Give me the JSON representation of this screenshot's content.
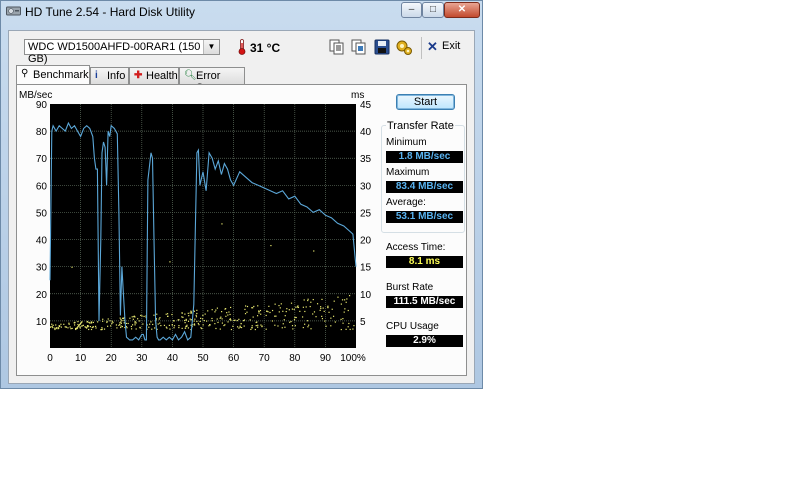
{
  "window": {
    "title": "HD Tune 2.54 - Hard Disk Utility",
    "caption_minimize": "–",
    "caption_maximize": "□",
    "caption_close": "✕"
  },
  "toolbar": {
    "drive": "WDC WD1500AHFD-00RAR1 (150 GB)",
    "temperature": "31 °C",
    "exit_label": "Exit",
    "icons": [
      "copy-text-icon",
      "copy-screenshot-icon",
      "save-icon",
      "options-icon",
      "exit-icon"
    ]
  },
  "tabs": [
    {
      "label": "Benchmark",
      "icon": "benchmark-icon",
      "active": true
    },
    {
      "label": "Info",
      "icon": "info-icon",
      "active": false
    },
    {
      "label": "Health",
      "icon": "health-icon",
      "active": false
    },
    {
      "label": "Error Scan",
      "icon": "error-scan-icon",
      "active": false
    }
  ],
  "buttons": {
    "start": "Start"
  },
  "stats": {
    "transfer_rate_title": "Transfer Rate",
    "minimum_label": "Minimum",
    "minimum_value": "1.8 MB/sec",
    "maximum_label": "Maximum",
    "maximum_value": "83.4 MB/sec",
    "average_label": "Average:",
    "average_value": "53.1 MB/sec",
    "access_time_label": "Access Time:",
    "access_time_value": "8.1 ms",
    "burst_rate_label": "Burst Rate",
    "burst_rate_value": "111.5 MB/sec",
    "cpu_usage_label": "CPU Usage",
    "cpu_usage_value": "2.9%"
  },
  "colors": {
    "chart_bg": "#000000",
    "grid": "#5f6f5f",
    "transfer_line": "#5ba7d8",
    "access_dots": "#e8e870",
    "blue_value": "#59b3f0",
    "yellow_value": "#ffff55",
    "white_value": "#ffffff"
  },
  "chart_data": {
    "type": "line",
    "ylabel": "MB/sec",
    "y2label": "ms",
    "ylim": [
      0,
      90
    ],
    "y2lim": [
      0,
      45
    ],
    "xlim": [
      0,
      100
    ],
    "x_ticks": [
      "0",
      "10",
      "20",
      "30",
      "40",
      "50",
      "60",
      "70",
      "80",
      "90",
      "100%"
    ],
    "y_ticks": [
      "90",
      "80",
      "70",
      "60",
      "50",
      "40",
      "30",
      "20",
      "10"
    ],
    "y2_ticks": [
      "45",
      "40",
      "35",
      "30",
      "25",
      "20",
      "15",
      "10",
      "5"
    ],
    "grid": true,
    "series": [
      {
        "axis": "left",
        "x": [
          0,
          0.6,
          1,
          2,
          3,
          4,
          5,
          6,
          7,
          8,
          9,
          10,
          11,
          12,
          13,
          14,
          14.5,
          15,
          15.5,
          16,
          16.6,
          17,
          17.5,
          18,
          18.5,
          19,
          19.5,
          20,
          21,
          21.5,
          22,
          22.5,
          23,
          23.5,
          24,
          24.5,
          25,
          26,
          27,
          28,
          29,
          30,
          30.5,
          31,
          31.5,
          32,
          33,
          33.5,
          34,
          34.5,
          35,
          35.5,
          36,
          37,
          38,
          39,
          40,
          41,
          42,
          43,
          44,
          45,
          46,
          47,
          48,
          48.5,
          49,
          50,
          51,
          52,
          53,
          54,
          55,
          56,
          57,
          58,
          59,
          60,
          62,
          64,
          66,
          68,
          70,
          72,
          74,
          76,
          78,
          80,
          82,
          84,
          86,
          88,
          90,
          92,
          94,
          96,
          98,
          99,
          100
        ],
        "y": [
          25,
          80,
          82,
          80,
          82,
          81,
          80,
          83,
          81,
          82,
          80,
          78,
          81,
          82,
          81,
          78,
          70,
          66,
          66,
          10,
          40,
          72,
          76,
          74,
          60,
          80,
          78,
          82,
          81,
          80,
          79,
          50,
          12,
          30,
          20,
          10,
          4,
          3,
          3,
          4,
          3,
          5,
          5,
          3,
          3,
          62,
          72,
          70,
          40,
          10,
          4,
          3,
          3,
          4,
          3,
          4,
          3,
          5,
          3,
          4,
          6,
          3,
          4,
          16,
          72,
          73,
          60,
          65,
          58,
          72,
          70,
          66,
          69,
          64,
          68,
          66,
          62,
          60,
          65,
          63,
          61,
          60,
          59,
          58,
          57,
          58,
          55,
          56,
          53,
          52,
          50,
          51,
          49,
          48,
          46,
          45,
          43,
          42,
          30
        ]
      },
      {
        "axis": "right",
        "kind": "scatter",
        "name": "access",
        "x_range": [
          0,
          100
        ],
        "y_range": [
          3,
          10
        ]
      }
    ]
  }
}
